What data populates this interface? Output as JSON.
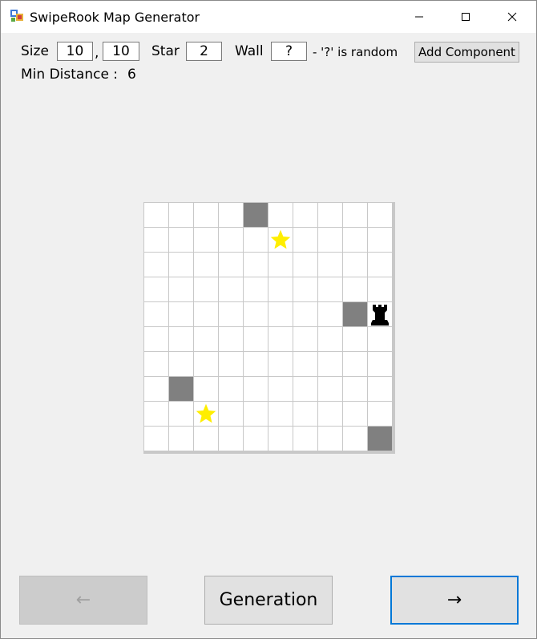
{
  "window": {
    "title": "SwipeRook Map Generator"
  },
  "controls": {
    "size_label": "Size",
    "size_width": "10",
    "size_separator": ",",
    "size_height": "10",
    "star_label": "Star",
    "star_value": "2",
    "wall_label": "Wall",
    "wall_value": "?",
    "wall_hint": "- '?' is random",
    "add_component_label": "Add Component",
    "min_distance_label": "Min Distance :",
    "min_distance_value": "6"
  },
  "board": {
    "rows": 10,
    "cols": 10,
    "walls": [
      [
        0,
        4
      ],
      [
        4,
        8
      ],
      [
        7,
        1
      ],
      [
        9,
        9
      ]
    ],
    "stars": [
      [
        1,
        5
      ],
      [
        8,
        2
      ]
    ],
    "rook": [
      4,
      9
    ],
    "colors": {
      "wall": "#808080",
      "star": "#ffee00",
      "cell": "#ffffff",
      "grid_line": "#c8c8c8"
    }
  },
  "buttons": {
    "prev_label": "←",
    "generate_label": "Generation",
    "next_label": "→"
  },
  "colors": {
    "focus_border": "#0078d7",
    "window_bg": "#f0f0f0"
  }
}
